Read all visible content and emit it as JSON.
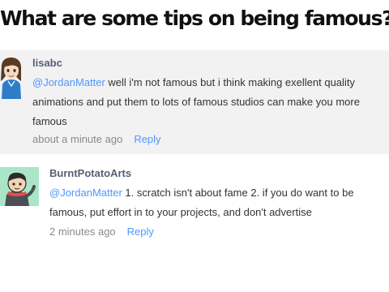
{
  "header": {
    "title": "What are some tips on being famous?"
  },
  "colors": {
    "mention": "#4d97ff",
    "reply": "#4d97ff",
    "author": "#575e75",
    "timestamp": "#8a8a8a",
    "highlight_bg": "#f2f2f2",
    "avatar2_bg": "#a9e6c8"
  },
  "comments": [
    {
      "author": "lisabc",
      "avatar_icon": "cartoon-girl-avatar",
      "mention": "@JordanMatter",
      "text": " well i'm not famous but i think making exellent quality animations and put them to lots of famous studios can make you more famous",
      "time": "about a minute ago",
      "reply_label": "Reply"
    },
    {
      "author": "BurntPotatoArts",
      "avatar_icon": "cartoon-character-avatar",
      "mention": "@JordanMatter",
      "text": " 1. scratch isn't about fame 2. if you do want to be famous, put effort in to your projects, and don't advertise",
      "time": "2 minutes ago",
      "reply_label": "Reply"
    }
  ]
}
